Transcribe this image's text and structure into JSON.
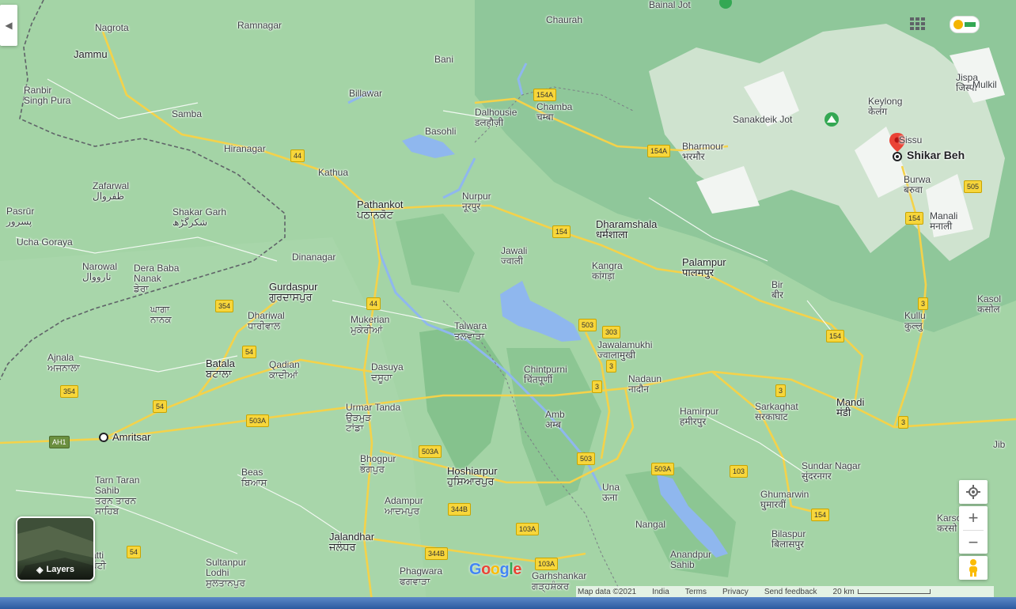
{
  "map": {
    "pin_label": "Shikar Beh",
    "labels": [
      {
        "id": "nagrota",
        "t": [
          "Nagrota"
        ]
      },
      {
        "id": "ramnagar",
        "t": [
          "Ramnagar"
        ]
      },
      {
        "id": "jammu",
        "t": [
          "Jammu"
        ]
      },
      {
        "id": "ranbir",
        "t": [
          "Ranbir",
          "Singh Pura"
        ]
      },
      {
        "id": "samba",
        "t": [
          "Samba"
        ]
      },
      {
        "id": "bani",
        "t": [
          "Bani"
        ]
      },
      {
        "id": "billawar",
        "t": [
          "Billawar"
        ]
      },
      {
        "id": "chaurah",
        "t": [
          "Chaurah"
        ]
      },
      {
        "id": "dalhousie",
        "t": [
          "Dalhousie",
          "डलहौज़ी"
        ]
      },
      {
        "id": "chamba",
        "t": [
          "Chamba",
          "चम्बा"
        ]
      },
      {
        "id": "basohli",
        "t": [
          "Basohli"
        ]
      },
      {
        "id": "hiranagar",
        "t": [
          "Hiranagar"
        ]
      },
      {
        "id": "kathua",
        "t": [
          "Kathua"
        ]
      },
      {
        "id": "zafarwal",
        "t": [
          "Zafarwal",
          "ظفروال"
        ]
      },
      {
        "id": "pasrur",
        "t": [
          "Pasrūr",
          "پسرور"
        ]
      },
      {
        "id": "shakargarh",
        "t": [
          "Shakar Garh",
          "شکرگڑھ"
        ]
      },
      {
        "id": "ucha",
        "t": [
          "Ucha Goraya"
        ]
      },
      {
        "id": "pathankot",
        "t": [
          "Pathankot",
          "ਪਠਾਨਕੋਟ"
        ]
      },
      {
        "id": "nurpur",
        "t": [
          "Nurpur",
          "नूरपुर"
        ]
      },
      {
        "id": "bharmour",
        "t": [
          "Bharmour",
          "भरमौर"
        ]
      },
      {
        "id": "sanakdeik",
        "t": [
          "Sanakdeik Jot"
        ]
      },
      {
        "id": "keylong",
        "t": [
          "Keylong",
          "केलंग"
        ]
      },
      {
        "id": "jispa",
        "t": [
          "Jispa",
          "जिस्पा"
        ]
      },
      {
        "id": "mulkil",
        "t": [
          "Mulkil"
        ]
      },
      {
        "id": "sissu",
        "t": [
          "Sissu"
        ]
      },
      {
        "id": "burwa",
        "t": [
          "Burwa",
          "बरुवा"
        ]
      },
      {
        "id": "manali",
        "t": [
          "Manali",
          "मनाली"
        ]
      },
      {
        "id": "dharamshala",
        "t": [
          "Dharamshala",
          "धर्मशाला"
        ]
      },
      {
        "id": "jawali",
        "t": [
          "Jawali",
          "ज्वाली"
        ]
      },
      {
        "id": "kangra",
        "t": [
          "Kangra",
          "कांगड़ा"
        ]
      },
      {
        "id": "palampur",
        "t": [
          "Palampur",
          "पालमपुर"
        ]
      },
      {
        "id": "bir",
        "t": [
          "Bir",
          "बीर"
        ]
      },
      {
        "id": "kullu",
        "t": [
          "Kullu",
          "कुल्लु"
        ]
      },
      {
        "id": "kasol",
        "t": [
          "Kasol",
          "कसोल"
        ]
      },
      {
        "id": "narowal",
        "t": [
          "Narowal",
          "نارووال"
        ]
      },
      {
        "id": "derababa",
        "t": [
          "Dera Baba",
          "Nanak",
          "ਡੇਰਾ"
        ]
      },
      {
        "id": "dinanagar",
        "t": [
          "Dinanagar"
        ]
      },
      {
        "id": "gurdaspur",
        "t": [
          "Gurdaspur",
          "ਗੁਰਦਾਸਪੁਰ"
        ]
      },
      {
        "id": "ghaga",
        "t": [
          "ਘਾਗਾ",
          "ਨਾਨਕ"
        ]
      },
      {
        "id": "dhariwal",
        "t": [
          "Dhariwal",
          "ਧਾਰੀਵਾਲ"
        ]
      },
      {
        "id": "mukerian",
        "t": [
          "Mukerian",
          "ਮੁਕੇਰੀਆਂ"
        ]
      },
      {
        "id": "talwara",
        "t": [
          "Talwara",
          "ਤਲਵਾੜਾ"
        ]
      },
      {
        "id": "jawalamukhi",
        "t": [
          "Jawalamukhi",
          "ज्वालामुखी"
        ]
      },
      {
        "id": "ajnala",
        "t": [
          "Ajnala",
          "ਅਜਨਾਲਾ"
        ]
      },
      {
        "id": "batala",
        "t": [
          "Batala",
          "ਬਟਾਲਾ"
        ]
      },
      {
        "id": "qadian",
        "t": [
          "Qadian",
          "ਕਾਦੀਆਂ"
        ]
      },
      {
        "id": "dasuya",
        "t": [
          "Dasuya",
          "ਦਸੂਹਾ"
        ]
      },
      {
        "id": "chintpurni",
        "t": [
          "Chintpurni",
          "चिंतपूर्णी"
        ]
      },
      {
        "id": "nadaun",
        "t": [
          "Nadaun",
          "नादौन"
        ]
      },
      {
        "id": "urmar",
        "t": [
          "Urmar Tanda",
          "ਉੜਮੁੜ",
          "ਟਾਂਡਾ"
        ]
      },
      {
        "id": "amb",
        "t": [
          "Amb",
          "अम्ब"
        ]
      },
      {
        "id": "hamirpur",
        "t": [
          "Hamirpur",
          "हमीरपुर"
        ]
      },
      {
        "id": "sarkaghat",
        "t": [
          "Sarkaghat",
          "सरकाघाट"
        ]
      },
      {
        "id": "mandi",
        "t": [
          "Mandi",
          "मंडी"
        ]
      },
      {
        "id": "amritsar",
        "t": [
          "Amritsar"
        ]
      },
      {
        "id": "bhogpur",
        "t": [
          "Bhogpur",
          "ਭੋਗਪੁਰ"
        ]
      },
      {
        "id": "hoshiarpur",
        "t": [
          "Hoshiarpur",
          "ਹੁਸ਼ਿਆਰਪੁਰ"
        ]
      },
      {
        "id": "beas",
        "t": [
          "Beas",
          "ਬਿਆਸ"
        ]
      },
      {
        "id": "tarntaran",
        "t": [
          "Tarn Taran",
          "Sahib",
          "ਤਰਨ ਤਾਰਨ",
          "ਸਾਹਿਬ"
        ]
      },
      {
        "id": "una",
        "t": [
          "Una",
          "ऊना"
        ]
      },
      {
        "id": "sundarnagar",
        "t": [
          "Sundar Nagar",
          "सुंदरनगर"
        ]
      },
      {
        "id": "jib",
        "t": [
          "Jib"
        ]
      },
      {
        "id": "adampur",
        "t": [
          "Adampur",
          "ਆਦਮਪੁਰ"
        ]
      },
      {
        "id": "ghumarwin",
        "t": [
          "Ghumarwin",
          "घुमारवीं"
        ]
      },
      {
        "id": "nangal",
        "t": [
          "Nangal"
        ]
      },
      {
        "id": "karso",
        "t": [
          "Karso",
          "करसो"
        ]
      },
      {
        "id": "bilaspur",
        "t": [
          "Bilaspur",
          "बिलासपुर"
        ]
      },
      {
        "id": "jalandhar",
        "t": [
          "Jalandhar",
          "ਜਲੰਧਰ"
        ]
      },
      {
        "id": "sultanpur",
        "t": [
          "Sultanpur",
          "Lodhi",
          "ਸੁਲਤਾਨਪੁਰ"
        ]
      },
      {
        "id": "patti",
        "t": [
          "atti",
          "ਪੱਟੀ"
        ]
      },
      {
        "id": "phagwara",
        "t": [
          "Phagwara",
          "ਫਗਵਾੜਾ"
        ]
      },
      {
        "id": "anandpur",
        "t": [
          "Anandpur",
          "Sahib"
        ]
      },
      {
        "id": "garhshankar",
        "t": [
          "Garhshankar",
          "ਗੜ੍ਹਸ਼ੰਕਰ"
        ]
      },
      {
        "id": "bainal",
        "t": [
          "Bainal Jot"
        ]
      }
    ],
    "shields": [
      "154A",
      "154A",
      "154",
      "44",
      "44",
      "154",
      "354",
      "54",
      "503",
      "303",
      "154",
      "3",
      "3",
      "354",
      "54",
      "503A",
      "503A",
      "3",
      "503",
      "503A",
      "103",
      "344B",
      "103A",
      "154",
      "3",
      "344B",
      "103A",
      "505",
      "AH1",
      "54",
      "3"
    ]
  },
  "controls": {
    "layers_label": "Layers",
    "zoom_in": "+",
    "zoom_out": "−",
    "side_toggle": "◀"
  },
  "footer": {
    "brand": "Google",
    "map_data": "Map data ©2021",
    "country": "India",
    "terms": "Terms",
    "privacy": "Privacy",
    "feedback": "Send feedback",
    "scale": "20 km"
  },
  "colors": {
    "land": "#9fd3a4",
    "road": "#f4d24a",
    "water": "#8fb7ee",
    "pin": "#ea4335"
  }
}
